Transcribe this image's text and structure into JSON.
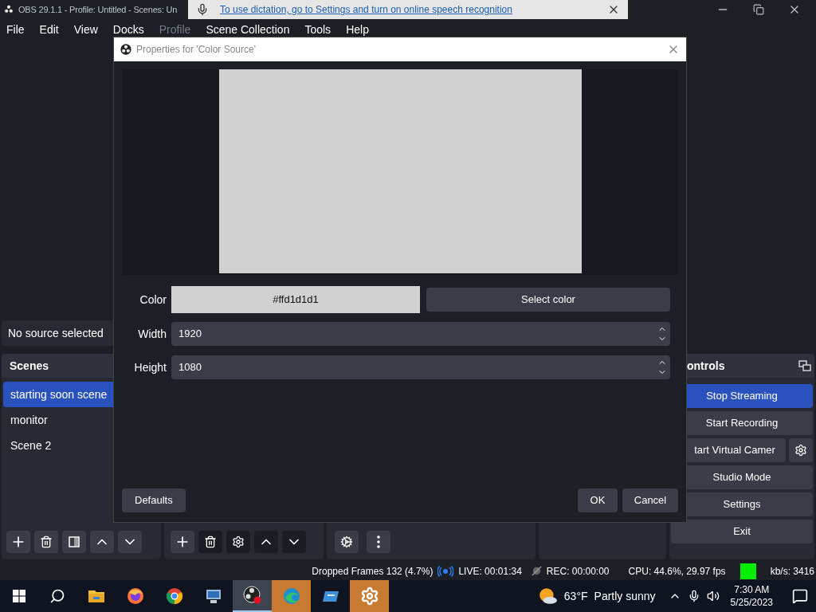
{
  "window": {
    "title": "OBS 29.1.1 - Profile: Untitled - Scenes: Un"
  },
  "dictation_banner": {
    "text": "To use dictation, go to Settings and turn on online speech recognition"
  },
  "menu": [
    {
      "label": "File",
      "disabled": false
    },
    {
      "label": "Edit",
      "disabled": false
    },
    {
      "label": "View",
      "disabled": false
    },
    {
      "label": "Docks",
      "disabled": false
    },
    {
      "label": "Profile",
      "disabled": true
    },
    {
      "label": "Scene Collection",
      "disabled": false
    },
    {
      "label": "Tools",
      "disabled": false
    },
    {
      "label": "Help",
      "disabled": false
    }
  ],
  "source_label": "No source selected",
  "scenes": {
    "title": "Scenes",
    "items": [
      {
        "label": "starting soon scene",
        "selected": true
      },
      {
        "label": "monitor",
        "selected": false
      },
      {
        "label": "Scene 2",
        "selected": false
      }
    ]
  },
  "controls": {
    "title": "ontrols",
    "buttons": [
      {
        "label": "Stop Streaming",
        "kind": "plain",
        "active": true
      },
      {
        "label": "Start Recording",
        "kind": "plain",
        "active": false
      },
      {
        "label": "tart Virtual Camer",
        "kind": "with-gear",
        "active": false
      },
      {
        "label": "Studio Mode",
        "kind": "plain",
        "active": false
      },
      {
        "label": "Settings",
        "kind": "plain",
        "active": false
      },
      {
        "label": "Exit",
        "kind": "plain",
        "active": false
      }
    ]
  },
  "dialog": {
    "title": "Properties for 'Color Source'",
    "fields": [
      {
        "kind": "color",
        "label": "Color",
        "value": "#ffd1d1d1",
        "button": "Select color"
      },
      {
        "kind": "spin",
        "label": "Width",
        "value": "1920"
      },
      {
        "kind": "spin",
        "label": "Height",
        "value": "1080"
      }
    ],
    "defaults": "Defaults",
    "ok": "OK",
    "cancel": "Cancel"
  },
  "status_bar": {
    "dropped": "Dropped Frames 132 (4.7%)",
    "live": "LIVE: 00:01:34",
    "rec": "REC: 00:00:00",
    "cpu": "CPU: 44.6%, 29.97 fps",
    "bitrate": "kb/s: 3416"
  },
  "taskbar": {
    "apps": [
      {
        "kind": "folder",
        "active": false,
        "flashing": false
      },
      {
        "kind": "firefox",
        "active": false,
        "flashing": false
      },
      {
        "kind": "chrome",
        "active": false,
        "flashing": false
      },
      {
        "kind": "computer",
        "active": false,
        "flashing": false
      },
      {
        "kind": "obs",
        "active": true,
        "flashing": false
      },
      {
        "kind": "edge",
        "active": false,
        "flashing": true
      },
      {
        "kind": "window",
        "active": false,
        "flashing": false
      },
      {
        "kind": "gear",
        "active": false,
        "flashing": true
      }
    ],
    "temperature": "63°F",
    "weather": "Partly sunny",
    "time": "7:30 AM",
    "date": "5/25/2023"
  }
}
